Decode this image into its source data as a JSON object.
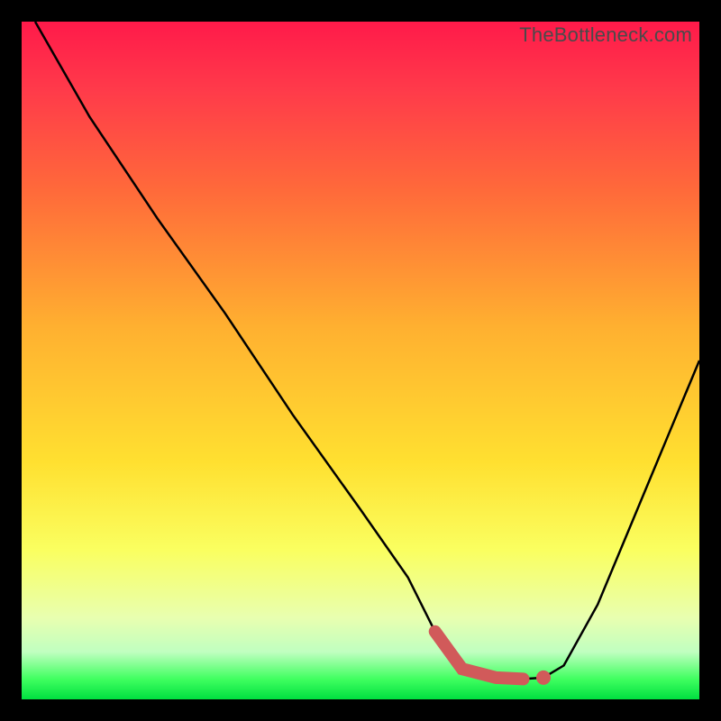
{
  "watermark": "TheBottleneck.com",
  "chart_data": {
    "type": "line",
    "title": "",
    "xlabel": "",
    "ylabel": "",
    "xlim": [
      0,
      100
    ],
    "ylim": [
      0,
      100
    ],
    "series": [
      {
        "name": "curve",
        "x": [
          2,
          10,
          20,
          30,
          40,
          50,
          57,
          61,
          65,
          70,
          74,
          77,
          80,
          85,
          90,
          95,
          100
        ],
        "values": [
          100,
          86,
          71,
          57,
          42,
          28,
          18,
          10,
          4.5,
          3.2,
          3.0,
          3.2,
          5.0,
          14,
          26,
          38,
          50
        ]
      }
    ],
    "highlight_segment": {
      "x_from": 61,
      "x_to": 74,
      "y": 3.1
    },
    "highlight_point": {
      "x": 77,
      "y": 3.2
    },
    "background_gradient": [
      "#ff1a4a",
      "#ffe030",
      "#00e040"
    ]
  }
}
